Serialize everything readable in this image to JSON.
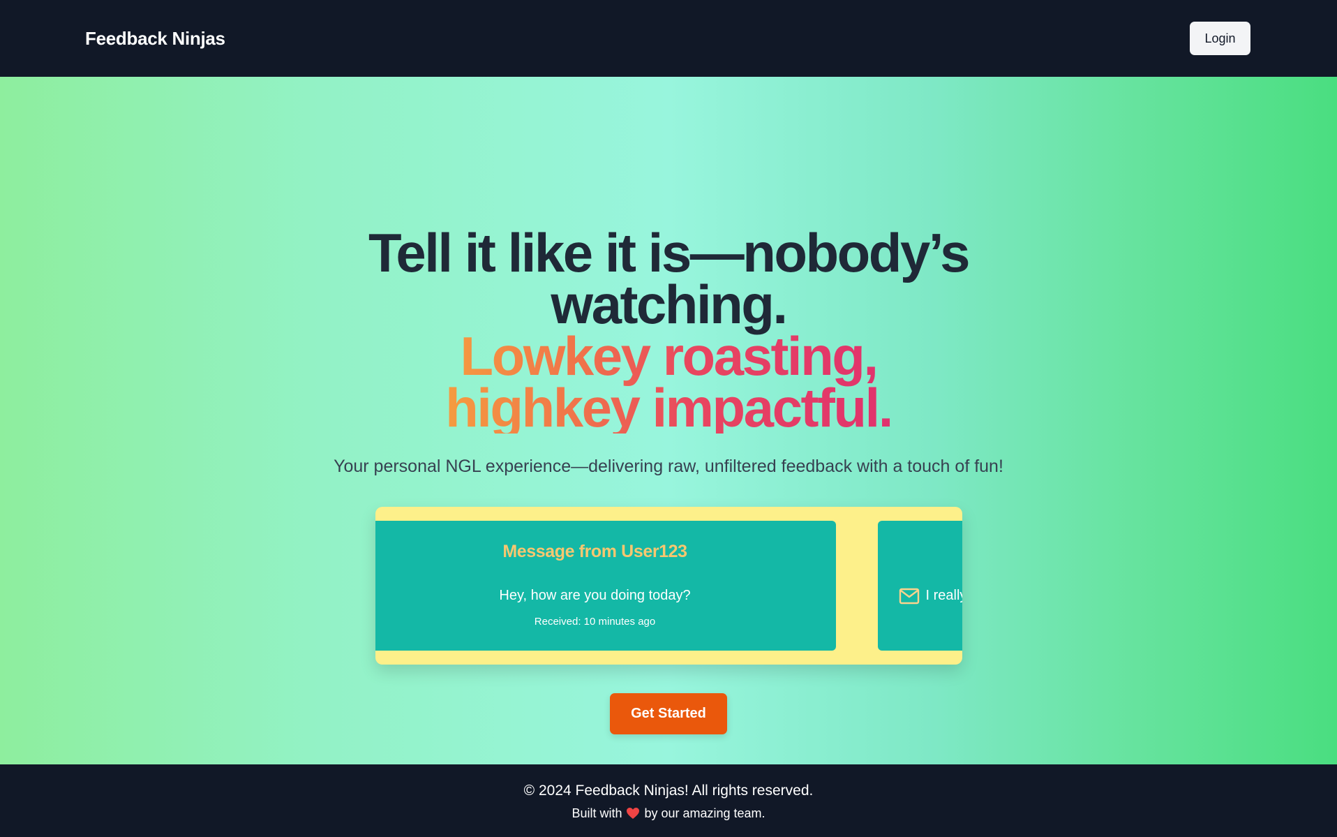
{
  "nav": {
    "brand": "Feedback Ninjas",
    "login_label": "Login"
  },
  "hero": {
    "headline_line1": "Tell it like it is—nobody’s watching.",
    "headline_line2": "Lowkey roasting, highkey impactful.",
    "subtitle": "Your personal NGL experience—delivering raw, unfiltered feedback with a touch of fun!",
    "cta_label": "Get Started"
  },
  "carousel": {
    "cards": [
      {
        "title": "Message from User123",
        "content": "Hey, how are you doing today?",
        "received": "Received: 10 minutes ago"
      },
      {
        "content": "I really liked your recent post!",
        "icon": "mail-icon"
      }
    ]
  },
  "footer": {
    "copyright": "© 2024 Feedback Ninjas! All rights reserved.",
    "built_prefix": "Built with",
    "built_suffix": "by our amazing team.",
    "heart_icon": "heart-icon"
  },
  "colors": {
    "nav_bg": "#111827",
    "card_bg": "#14b8a6",
    "carousel_bg": "#fdf08a",
    "card_title": "#f7c770",
    "cta_bg": "#ea580c",
    "heading": "#1f2937"
  }
}
